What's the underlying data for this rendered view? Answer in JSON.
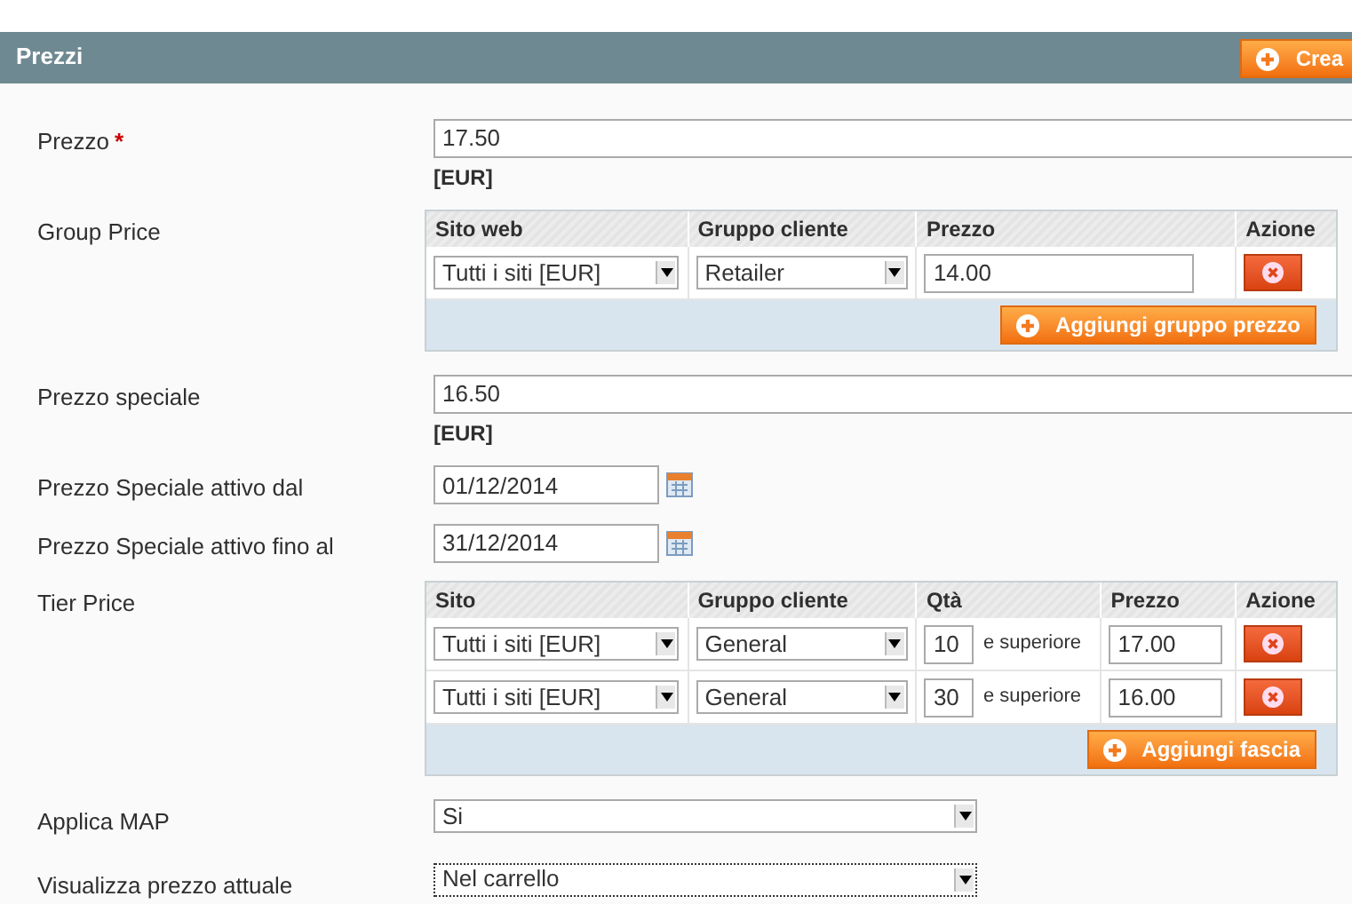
{
  "section": {
    "title": "Prezzi",
    "button": "Crea"
  },
  "rows": [
    {
      "kind": "text",
      "label": "Prezzo",
      "required_mark": "*",
      "value": "17.50",
      "note": "[EUR]"
    },
    {
      "kind": "table",
      "label": "Group Price",
      "columns": [
        {
          "label": "Sito web",
          "kind": "select"
        },
        {
          "label": "Gruppo cliente",
          "kind": "select"
        },
        {
          "label": "Prezzo",
          "kind": "input"
        },
        {
          "label": "Azione",
          "kind": "delete"
        }
      ],
      "entries": [
        [
          "Tutti i siti [EUR]",
          "Retailer",
          "14.00"
        ]
      ],
      "add_button": "Aggiungi gruppo prezzo"
    },
    {
      "kind": "text",
      "label": "Prezzo speciale",
      "value": "16.50",
      "note": "[EUR]"
    },
    {
      "kind": "date",
      "label": "Prezzo Speciale attivo dal",
      "value": "01/12/2014"
    },
    {
      "kind": "date",
      "label": "Prezzo Speciale attivo fino al",
      "value": "31/12/2014"
    },
    {
      "kind": "table",
      "label": "Tier Price",
      "columns": [
        {
          "label": "Sito",
          "kind": "select"
        },
        {
          "label": "Gruppo cliente",
          "kind": "select"
        },
        {
          "label": "Qtà",
          "kind": "qty"
        },
        {
          "label": "Prezzo",
          "kind": "small_input"
        },
        {
          "label": "Azione",
          "kind": "delete"
        }
      ],
      "entries": [
        [
          "Tutti i siti [EUR]",
          "General",
          "10",
          "e superiore",
          "17.00"
        ],
        [
          "Tutti i siti [EUR]",
          "General",
          "30",
          "e superiore",
          "16.00"
        ]
      ],
      "add_button": "Aggiungi fascia"
    },
    {
      "kind": "select",
      "label": "Applica MAP",
      "value": "Si",
      "focused": false
    },
    {
      "kind": "select",
      "label": "Visualizza prezzo attuale",
      "value": "Nel carrello",
      "focused": true
    }
  ]
}
